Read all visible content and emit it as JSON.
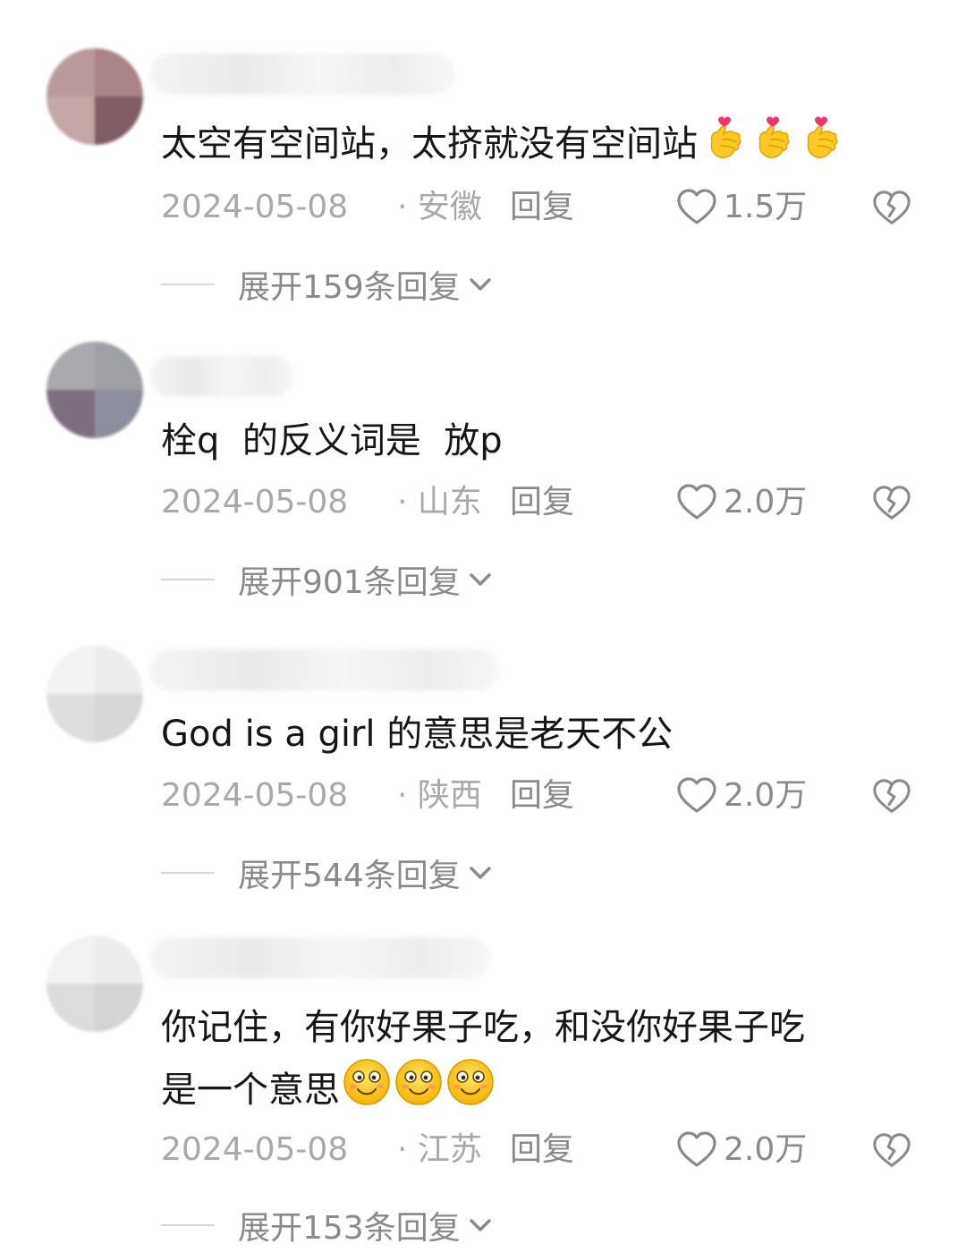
{
  "comments": [
    {
      "text": "太空有空间站，太挤就没有空间站",
      "date": "2024-05-08",
      "region": "· 安徽",
      "reply_label": "回复",
      "likes": "1.5万",
      "expand_label": "展开159条回复",
      "trailing_emoji": "finger-heart-icon",
      "emoji_count": 3
    },
    {
      "text": "栓q  的反义词是  放p",
      "date": "2024-05-08",
      "region": "· 山东",
      "reply_label": "回复",
      "likes": "2.0万",
      "expand_label": "展开901条回复"
    },
    {
      "text": "God is a girl 的意思是老天不公",
      "date": "2024-05-08",
      "region": "· 陕西",
      "reply_label": "回复",
      "likes": "2.0万",
      "expand_label": "展开544条回复"
    },
    {
      "text_line1": "你记住，有你好果子吃，和没你好果子吃",
      "text_line2": "是一个意思",
      "date": "2024-05-08",
      "region": "· 江苏",
      "reply_label": "回复",
      "likes": "2.0万",
      "expand_label": "展开153条回复",
      "trailing_emoji": "smiling-face-icon",
      "emoji_count": 3
    }
  ],
  "colors": {
    "text": "#161616",
    "meta": "#a9a9a9",
    "action": "#8a8a8a",
    "divider": "#d6d6d6"
  }
}
